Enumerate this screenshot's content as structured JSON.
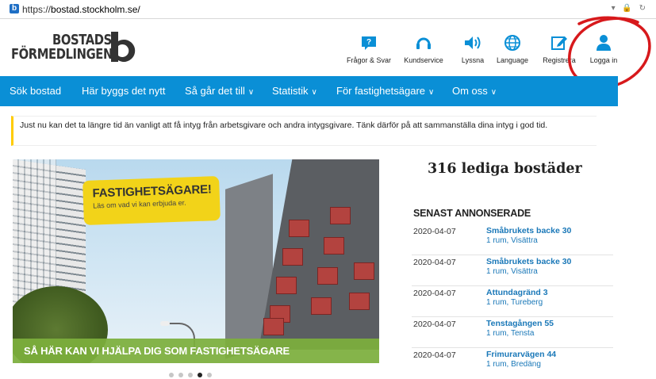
{
  "browser": {
    "url_scheme": "https://",
    "url_host": "bostad.stockholm.se/",
    "favicon": "b",
    "controls": "▾ 🔒 ↻"
  },
  "header": {
    "logo_line1": "BOSTADS",
    "logo_line2": "FÖRMEDLINGEN",
    "logo_mark": "b-logo-icon",
    "icons": [
      {
        "label": "Frågor & Svar",
        "icon": "question-icon"
      },
      {
        "label": "Kundservice",
        "icon": "headset-icon"
      },
      {
        "label": "Lyssna",
        "icon": "speaker-icon"
      },
      {
        "label": "Language",
        "icon": "globe-icon"
      },
      {
        "label": "Registrera",
        "icon": "edit-icon"
      },
      {
        "label": "Logga in",
        "icon": "user-icon"
      }
    ]
  },
  "nav": {
    "items": [
      {
        "label": "Sök bostad",
        "has_dropdown": false
      },
      {
        "label": "Här byggs det nytt",
        "has_dropdown": false
      },
      {
        "label": "Så går det till",
        "has_dropdown": true
      },
      {
        "label": "Statistik",
        "has_dropdown": true
      },
      {
        "label": "För fastighetsägare",
        "has_dropdown": true
      },
      {
        "label": "Om oss",
        "has_dropdown": true
      }
    ],
    "chevron": "∨"
  },
  "notice": {
    "text": "Just nu kan det ta längre tid än vanligt att få intyg från arbetsgivare och andra intygsgivare. Tänk därför på att sammanställa dina intyg i god tid."
  },
  "hero": {
    "sign_title": "FASTIGHETSÄGARE!",
    "sign_sub": "Läs om vad vi kan erbjuda er.",
    "banner": "SÅ HÄR KAN VI HJÄLPA DIG SOM FASTIGHETSÄGARE",
    "dots": 5,
    "active_dot": 4
  },
  "sidebar": {
    "count_heading": "316 lediga bostäder",
    "recent_heading": "SENAST ANNONSERADE",
    "listings": [
      {
        "date": "2020-04-07",
        "street": "Småbrukets backe 30",
        "info": "1 rum, Visättra"
      },
      {
        "date": "2020-04-07",
        "street": "Småbrukets backe 30",
        "info": "1 rum, Visättra"
      },
      {
        "date": "2020-04-07",
        "street": "Attundagränd 3",
        "info": "1 rum, Tureberg"
      },
      {
        "date": "2020-04-07",
        "street": "Tenstagången 55",
        "info": "1 rum, Tensta"
      },
      {
        "date": "2020-04-07",
        "street": "Frimurarvägen 44",
        "info": "1 rum, Bredäng"
      }
    ]
  },
  "colors": {
    "nav_bg": "#0a8fd6",
    "accent_yellow": "#ffcc00",
    "link_blue": "#1a78b8",
    "banner_green": "#7daf3c",
    "annotation_red": "#d7191c"
  }
}
